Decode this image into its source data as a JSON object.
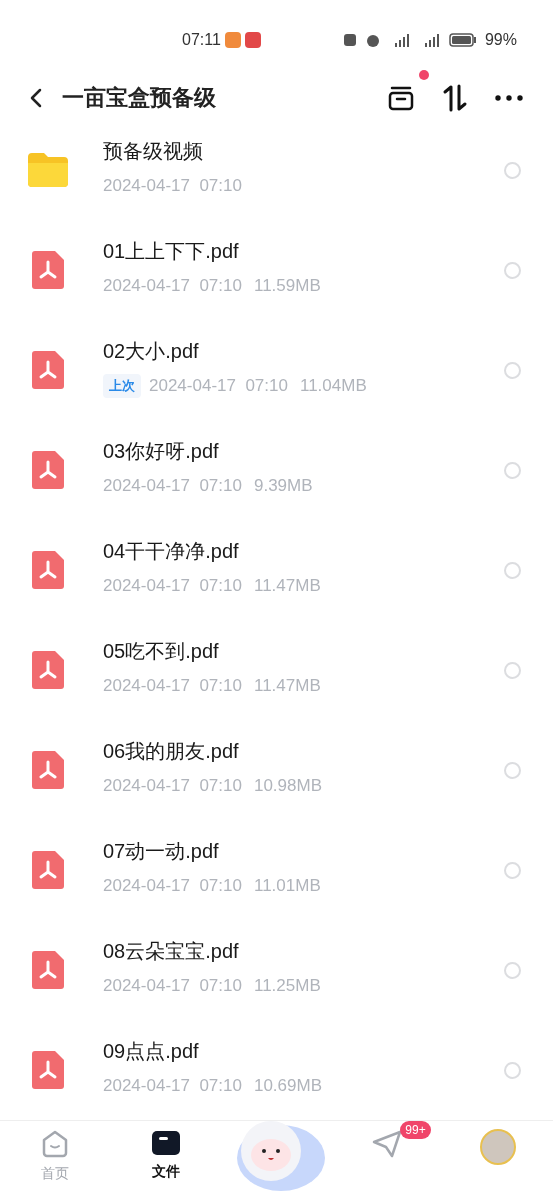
{
  "status_bar": {
    "time": "07:11",
    "battery": "99%"
  },
  "header": {
    "title": "一亩宝盒预备级",
    "notification_dot": true
  },
  "files": [
    {
      "kind": "folder",
      "name": "预备级视频",
      "date": "2024-04-17  07:10",
      "selected": false
    },
    {
      "kind": "pdf",
      "name": "01上上下下.pdf",
      "date": "2024-04-17  07:10",
      "size": "11.59MB",
      "selected": false
    },
    {
      "kind": "pdf",
      "name": "02大小.pdf",
      "date": "2024-04-17  07:10",
      "size": "11.04MB",
      "badge": "上次",
      "selected": false
    },
    {
      "kind": "pdf",
      "name": "03你好呀.pdf",
      "date": "2024-04-17  07:10",
      "size": "9.39MB",
      "selected": false
    },
    {
      "kind": "pdf",
      "name": "04干干净净.pdf",
      "date": "2024-04-17  07:10",
      "size": "11.47MB",
      "selected": false
    },
    {
      "kind": "pdf",
      "name": "05吃不到.pdf",
      "date": "2024-04-17  07:10",
      "size": "11.47MB",
      "selected": false
    },
    {
      "kind": "pdf",
      "name": "06我的朋友.pdf",
      "date": "2024-04-17  07:10",
      "size": "10.98MB",
      "selected": false
    },
    {
      "kind": "pdf",
      "name": "07动一动.pdf",
      "date": "2024-04-17  07:10",
      "size": "11.01MB",
      "selected": false
    },
    {
      "kind": "pdf",
      "name": "08云朵宝宝.pdf",
      "date": "2024-04-17  07:10",
      "size": "11.25MB",
      "selected": false
    },
    {
      "kind": "pdf",
      "name": "09点点.pdf",
      "date": "2024-04-17  07:10",
      "size": "10.69MB",
      "selected": false
    }
  ],
  "bottom_nav": [
    {
      "kind": "home",
      "label": "首页",
      "selected": false
    },
    {
      "kind": "files",
      "label": "文件",
      "selected": true
    },
    {
      "kind": "mascot",
      "selected": false
    },
    {
      "kind": "messages",
      "badge": "99+",
      "selected": false
    },
    {
      "kind": "profile",
      "selected": false
    }
  ]
}
